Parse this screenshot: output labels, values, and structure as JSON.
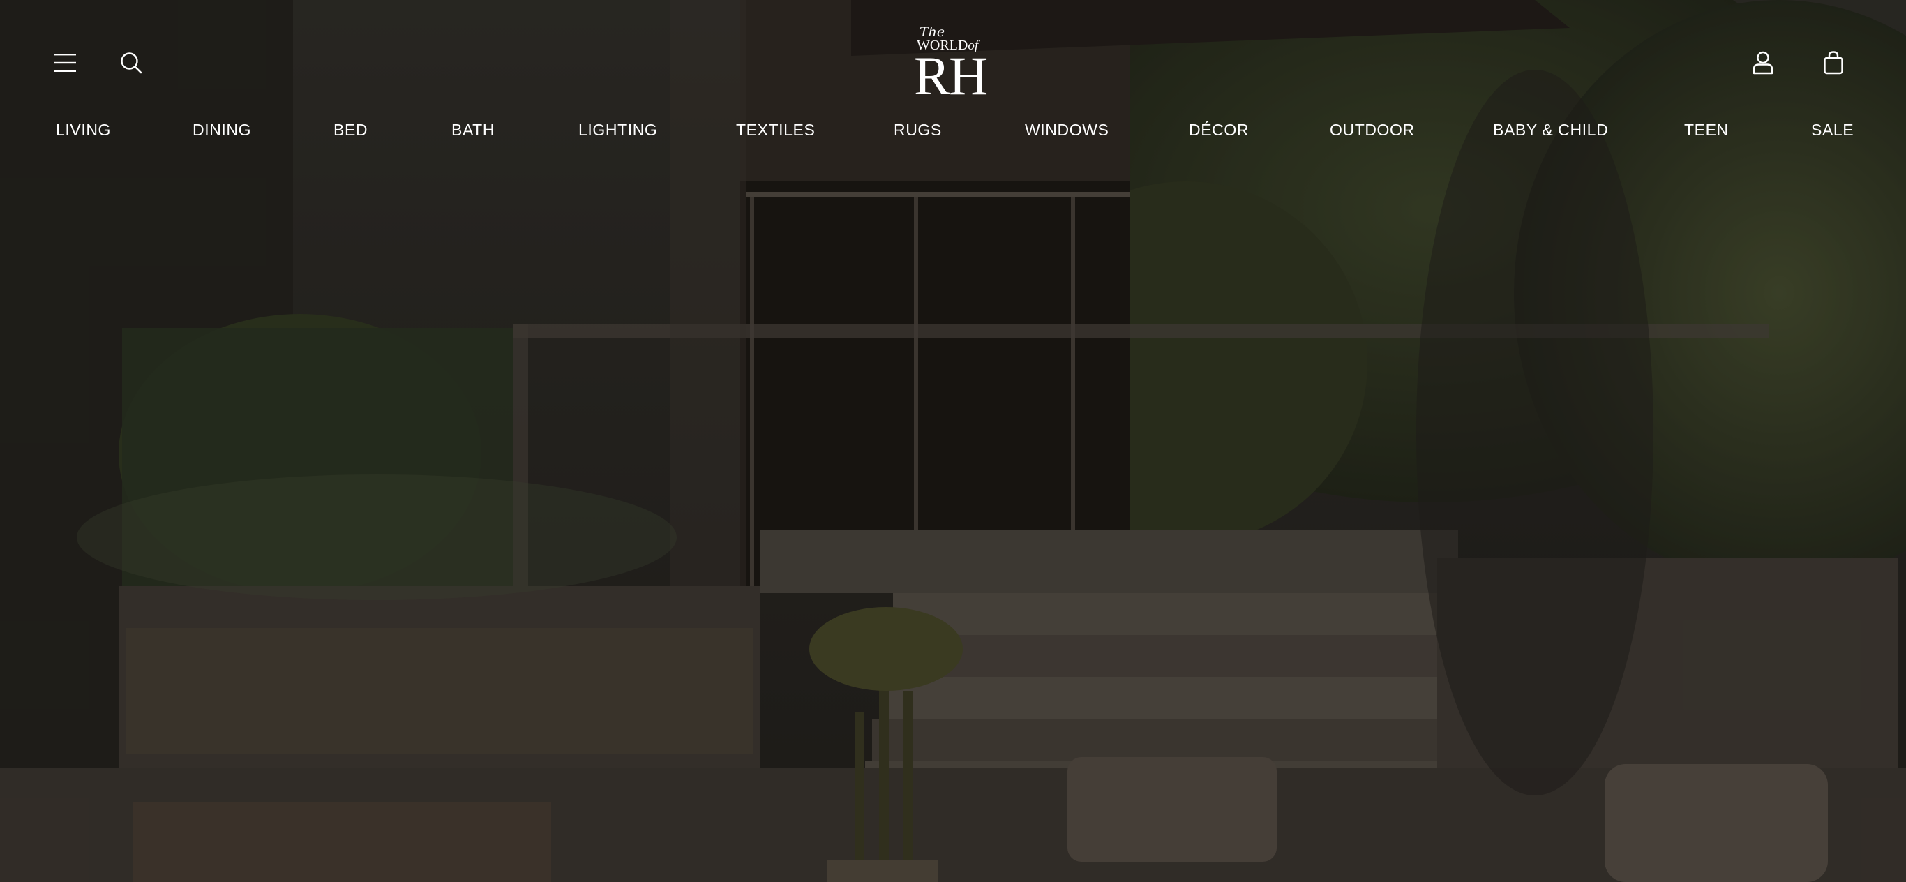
{
  "header": {
    "logo": {
      "line1": "The",
      "line2a": "WORLD",
      "line2b": "of",
      "mark": "RH"
    },
    "icons": {
      "menu": "hamburger-menu-icon",
      "search": "search-icon",
      "account": "account-icon",
      "cart": "shopping-bag-icon"
    }
  },
  "nav": {
    "items": [
      {
        "label": "LIVING"
      },
      {
        "label": "DINING"
      },
      {
        "label": "BED"
      },
      {
        "label": "BATH"
      },
      {
        "label": "LIGHTING"
      },
      {
        "label": "TEXTILES"
      },
      {
        "label": "RUGS"
      },
      {
        "label": "WINDOWS"
      },
      {
        "label": "DÉCOR"
      },
      {
        "label": "OUTDOOR"
      },
      {
        "label": "BABY & CHILD"
      },
      {
        "label": "TEEN"
      },
      {
        "label": "SALE"
      }
    ]
  },
  "colors": {
    "text": "#ffffff",
    "overlay": "#080604"
  }
}
